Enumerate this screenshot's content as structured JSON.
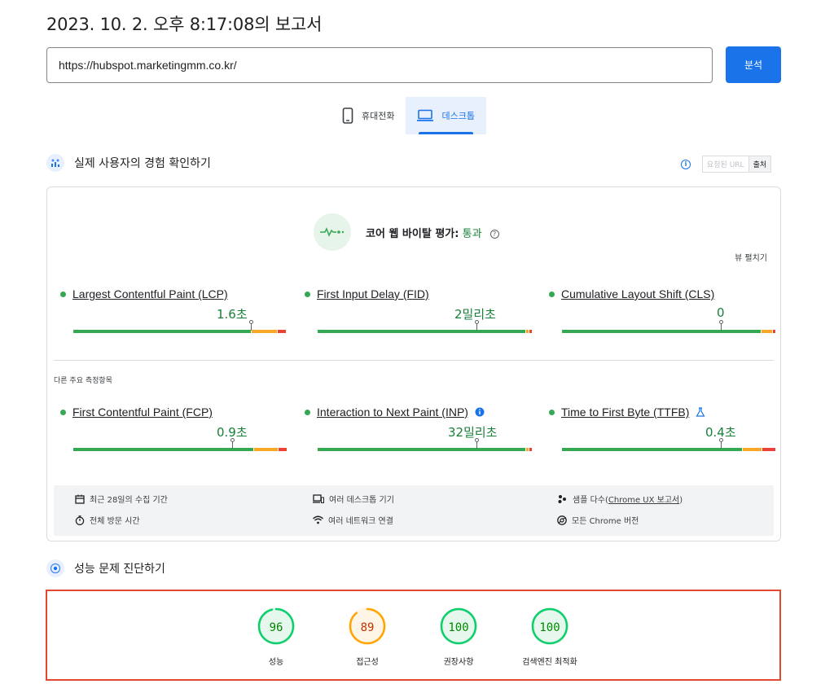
{
  "report": {
    "title": "2023. 10. 2. 오후 8:17:08의 보고서"
  },
  "search": {
    "url": "https://hubspot.marketingmm.co.kr/",
    "analyze_label": "분석"
  },
  "device_tabs": [
    {
      "label": "휴대전화",
      "icon": "mobile-icon",
      "active": false
    },
    {
      "label": "데스크톱",
      "icon": "desktop-icon",
      "active": true
    }
  ],
  "field": {
    "title": "실제 사용자의 경험 확인하기",
    "url_chip": "요청된 URL",
    "source_chip": "출처",
    "cwv_label": "코어 웹 바이탈 평가:",
    "cwv_result": "통과",
    "expand_label": "뷰 펼치기",
    "other_metrics_label": "다른 주요 측정항목",
    "core_metrics": [
      {
        "name": "Largest Contentful Paint (LCP)",
        "value": "1.6초",
        "distribution": [
          0.84,
          0.12,
          0.04
        ],
        "marker": 0.84
      },
      {
        "name": "First Input Delay (FID)",
        "value": "2밀리초",
        "distribution": [
          0.98,
          0.01,
          0.01
        ],
        "marker": 0.75
      },
      {
        "name": "Cumulative Layout Shift (CLS)",
        "value": "0",
        "distribution": [
          0.94,
          0.05,
          0.01
        ],
        "marker": 0.75
      }
    ],
    "other_metrics": [
      {
        "name": "First Contentful Paint (FCP)",
        "value": "0.9초",
        "distribution": [
          0.85,
          0.11,
          0.04
        ],
        "marker": 0.75,
        "suffix_icon": ""
      },
      {
        "name": "Interaction to Next Paint (INP)",
        "value": "32밀리초",
        "distribution": [
          0.98,
          0.01,
          0.01
        ],
        "marker": 0.75,
        "suffix_icon": "info-icon"
      },
      {
        "name": "Time to First Byte (TTFB)",
        "value": "0.4초",
        "distribution": [
          0.85,
          0.09,
          0.06
        ],
        "marker": 0.75,
        "suffix_icon": "flask-icon"
      }
    ],
    "conditions": [
      {
        "icon": "calendar-icon",
        "text": "최근 28일의 수집 기간"
      },
      {
        "icon": "devices-icon",
        "text": "여러 데스크톱 기기"
      },
      {
        "icon": "people-icon",
        "text_before": "샘플 다수(",
        "link": "Chrome UX 보고서",
        "text_after": ")"
      },
      {
        "icon": "timer-icon",
        "text": "전체 방문 시간"
      },
      {
        "icon": "wifi-icon",
        "text": "여러 네트워크 연결"
      },
      {
        "icon": "chrome-icon",
        "text": "모든 Chrome 버전"
      }
    ]
  },
  "diagnose": {
    "title": "성능 문제 진단하기",
    "scores": [
      {
        "label": "성능",
        "score": 96,
        "color": "#0cce6b",
        "text_color": "#008800",
        "bg": "#e6f8ee"
      },
      {
        "label": "접근성",
        "score": 89,
        "color": "#ffa400",
        "text_color": "#c33300",
        "bg": "#fff5e6"
      },
      {
        "label": "권장사항",
        "score": 100,
        "color": "#0cce6b",
        "text_color": "#008800",
        "bg": "#e6f8ee"
      },
      {
        "label": "검색엔진 최적화",
        "score": 100,
        "color": "#0cce6b",
        "text_color": "#008800",
        "bg": "#e6f8ee"
      }
    ]
  }
}
